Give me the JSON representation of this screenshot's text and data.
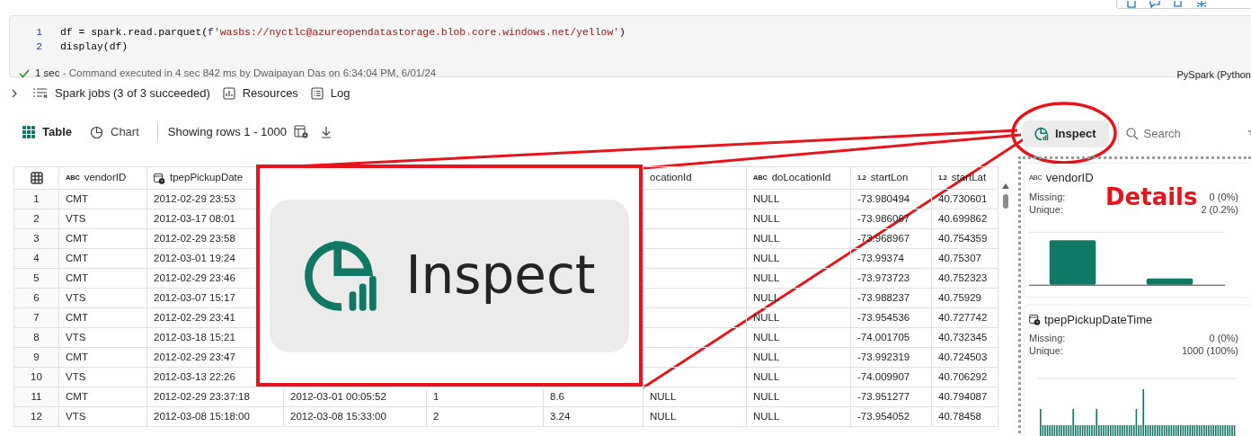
{
  "cell": {
    "lines": [
      {
        "number": "1",
        "tokens": [
          {
            "text": "df = spark.read.parquet(",
            "kind": "plain"
          },
          {
            "text": "f",
            "kind": "keyword"
          },
          {
            "text": "'wasbs://nyctlc@azureopendatastorage.blob.core.windows.net/yellow'",
            "kind": "string"
          },
          {
            "text": ")",
            "kind": "plain"
          }
        ]
      },
      {
        "number": "2",
        "tokens": [
          {
            "text": "display(df)",
            "kind": "plain"
          }
        ]
      }
    ],
    "status": {
      "succeeded": true,
      "duration": "1 sec",
      "message": "- Command executed in 4 sec 842 ms by Dwaipayan Das on 6:34:04 PM, 6/01/24"
    },
    "language": "PySpark (Python"
  },
  "output_bar": {
    "expanded": false,
    "items": [
      {
        "kind": "jobs",
        "label": "Spark jobs (3 of 3 succeeded)"
      },
      {
        "kind": "resources",
        "label": "Resources"
      },
      {
        "kind": "log",
        "label": "Log"
      }
    ]
  },
  "view_tabs": [
    {
      "kind": "table",
      "label": "Table",
      "selected": true
    },
    {
      "kind": "chart",
      "label": "Chart",
      "selected": false
    }
  ],
  "row_range": "Showing rows 1 - 1000",
  "inspect_button": {
    "label": "Inspect"
  },
  "search": {
    "placeholder": "Search"
  },
  "table": {
    "columns": [
      {
        "kind": "index"
      },
      {
        "kind": "text",
        "type_label": "ABC",
        "label": "vendorID"
      },
      {
        "kind": "datetime",
        "label": "tpepPickupDate"
      },
      null,
      null,
      null,
      {
        "kind": "plain",
        "label": "ocationId"
      },
      {
        "kind": "text",
        "type_label": "ABC",
        "label": "doLocationId"
      },
      {
        "kind": "number",
        "type_label": "1.2",
        "label": "startLon"
      },
      {
        "kind": "number",
        "type_label": "1.2",
        "label": "startLat"
      }
    ],
    "rows": [
      [
        "1",
        "CMT",
        "2012-02-29 23:53",
        null,
        null,
        null,
        null,
        "NULL",
        "-73.980494",
        "40.730601"
      ],
      [
        "2",
        "VTS",
        "2012-03-17 08:01",
        null,
        null,
        null,
        null,
        "NULL",
        "-73.986067",
        "40.699862"
      ],
      [
        "3",
        "CMT",
        "2012-02-29 23:58",
        null,
        null,
        null,
        null,
        "NULL",
        "-73.968967",
        "40.754359"
      ],
      [
        "4",
        "CMT",
        "2012-03-01 19:24",
        null,
        null,
        null,
        null,
        "NULL",
        "-73.99374",
        "40.75307"
      ],
      [
        "5",
        "CMT",
        "2012-02-29 23:46",
        null,
        null,
        null,
        null,
        "NULL",
        "-73.973723",
        "40.752323"
      ],
      [
        "6",
        "VTS",
        "2012-03-07 15:17",
        null,
        null,
        null,
        null,
        "NULL",
        "-73.988237",
        "40.75929"
      ],
      [
        "7",
        "CMT",
        "2012-02-29 23:41",
        null,
        null,
        null,
        null,
        "NULL",
        "-73.954536",
        "40.727742"
      ],
      [
        "8",
        "VTS",
        "2012-03-18 15:21",
        null,
        null,
        null,
        null,
        "NULL",
        "-74.001705",
        "40.732345"
      ],
      [
        "9",
        "CMT",
        "2012-02-29 23:47",
        null,
        null,
        null,
        null,
        "NULL",
        "-73.992319",
        "40.724503"
      ],
      [
        "10",
        "VTS",
        "2012-03-13 22:26",
        null,
        null,
        null,
        null,
        "NULL",
        "-74.009907",
        "40.706292"
      ],
      [
        "11",
        "CMT",
        "2012-02-29 23:37:18",
        "2012-03-01 00:05:52",
        "1",
        "8.6",
        "NULL",
        "NULL",
        "-73.951277",
        "40.794087"
      ],
      [
        "12",
        "VTS",
        "2012-03-08 15:18:00",
        "2012-03-08 15:33:00",
        "2",
        "3.24",
        "NULL",
        "NULL",
        "-73.954052",
        "40.78458"
      ]
    ]
  },
  "callout": {
    "label": "Inspect"
  },
  "details": {
    "annotation": "Details",
    "cards": [
      {
        "kind": "text",
        "type_label": "ABC",
        "name": "vendorID",
        "stats": [
          {
            "label": "Missing:",
            "value": "0 (0%)"
          },
          {
            "label": "Unique:",
            "value": "2 (0.2%)"
          }
        ]
      },
      {
        "kind": "datetime",
        "name": "tpepPickupDateTime",
        "stats": [
          {
            "label": "Missing:",
            "value": "0 (0%)"
          },
          {
            "label": "Unique:",
            "value": "1000 (100%)"
          }
        ]
      }
    ]
  }
}
